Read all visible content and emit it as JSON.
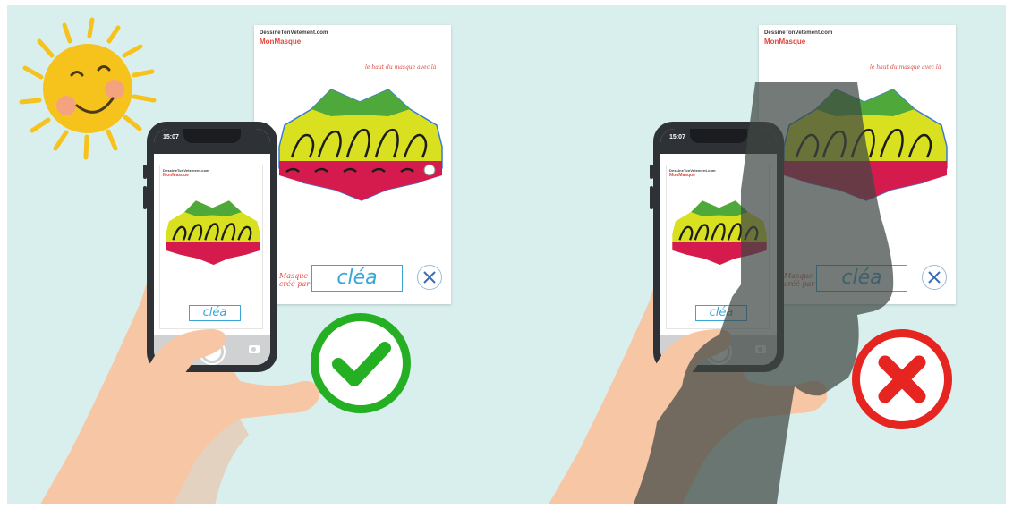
{
  "sheet": {
    "brand": "DessineTonVetement.com",
    "title": "MonMasque",
    "handwritten_note": "le haut du masque avec là",
    "signature_label": "Masque\ncréé par :",
    "name": "cléa"
  },
  "phone": {
    "time": "15:07"
  },
  "panels": [
    {
      "id": "left",
      "verdict": "check-icon",
      "verdict_color": "#25b024"
    },
    {
      "id": "right",
      "verdict": "cross-icon",
      "verdict_color": "#e62521"
    }
  ],
  "colors": {
    "background": "#d9efee",
    "mask_yellow": "#d8e01f",
    "mask_green": "#4fa83a",
    "mask_red": "#d51b4d",
    "shadow": "#6e7671",
    "sun": "#f6c21c"
  }
}
